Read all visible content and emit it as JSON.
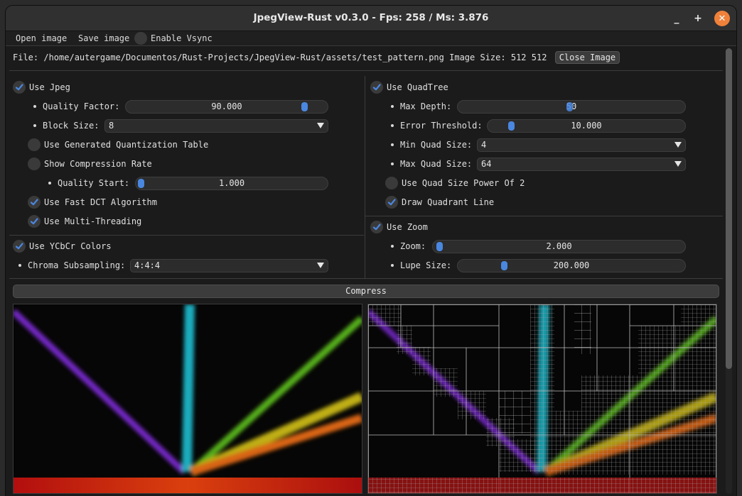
{
  "window": {
    "title": "JpegView-Rust v0.3.0 - Fps: 258 / Ms: 3.876",
    "min_glyph": "_",
    "max_glyph": "+",
    "close_glyph": "✕"
  },
  "menu": {
    "open_image": "Open image",
    "save_image": "Save image",
    "enable_vsync": "Enable Vsync",
    "vsync_checked": false
  },
  "file": {
    "label": "File:",
    "path": "/home/autergame/Documentos/Rust-Projects/JpegView-Rust/assets/test_pattern.png",
    "size_label": "Image Size:",
    "width": "512",
    "height": "512",
    "close_button": "Close Image"
  },
  "jpeg": {
    "use_jpeg": "Use Jpeg",
    "quality_factor_label": "Quality Factor:",
    "quality_factor_value": "90.000",
    "quality_factor_fraction": 0.9,
    "block_size_label": "Block Size:",
    "block_size_value": "8",
    "gen_quant_label": "Use Generated Quantization Table",
    "gen_quant_checked": false,
    "show_rate_label": "Show Compression Rate",
    "show_rate_checked": false,
    "quality_start_label": "Quality Start:",
    "quality_start_value": "1.000",
    "quality_start_fraction": 0.0,
    "fast_dct_label": "Use Fast DCT Algorithm",
    "fast_dct_checked": true,
    "multithread_label": "Use Multi-Threading",
    "multithread_checked": true
  },
  "ycbcr": {
    "use_ycbcr": "Use YCbCr Colors",
    "chroma_label": "Chroma Subsampling:",
    "chroma_value": "4:4:4"
  },
  "quadtree": {
    "use_quadtree": "Use QuadTree",
    "max_depth_label": "Max Depth:",
    "max_depth_value": "50",
    "error_threshold_label": "Error Threshold:",
    "error_threshold_value": "10.000",
    "min_quad_label": "Min Quad Size:",
    "min_quad_value": "4",
    "max_quad_label": "Max Quad Size:",
    "max_quad_value": "64",
    "power_of_2_label": "Use Quad Size Power Of 2",
    "power_of_2_checked": false,
    "draw_lines_label": "Draw Quadrant Line",
    "draw_lines_checked": true
  },
  "zoom": {
    "use_zoom": "Use Zoom",
    "zoom_label": "Zoom:",
    "zoom_value": "2.000",
    "lupe_label": "Lupe Size:",
    "lupe_value": "200.000"
  },
  "actions": {
    "compress": "Compress"
  },
  "colors": {
    "accent": "#4a87e0",
    "close": "#f0813a",
    "panel": "#1b1b1b"
  }
}
